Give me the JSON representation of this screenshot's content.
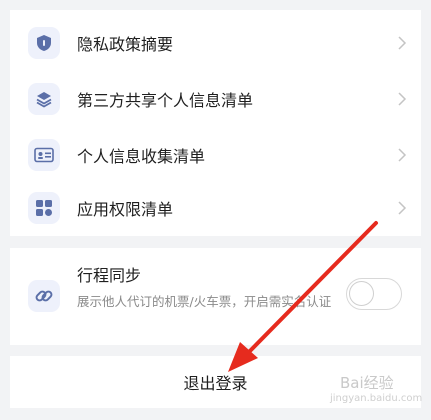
{
  "privacy_list": {
    "items": [
      {
        "label": "隐私政策摘要",
        "icon": "shield-icon"
      },
      {
        "label": "第三方共享个人信息清单",
        "icon": "layers-icon"
      },
      {
        "label": "个人信息收集清单",
        "icon": "id-card-icon"
      },
      {
        "label": "应用权限清单",
        "icon": "grid-apps-icon"
      }
    ]
  },
  "trip_sync": {
    "title": "行程同步",
    "description": "展示他人代订的机票/火车票，开启需实名认证",
    "icon": "link-icon",
    "enabled": false
  },
  "logout": {
    "label": "退出登录"
  },
  "watermark": {
    "brand": "Bai经验",
    "url": "jingyan.baidu.com"
  },
  "colors": {
    "background": "#f2f3f5",
    "card": "#ffffff",
    "icon_tile": "#eef1fb",
    "icon_accent": "#5b6fa8",
    "annotation_arrow": "#e62b1e"
  }
}
